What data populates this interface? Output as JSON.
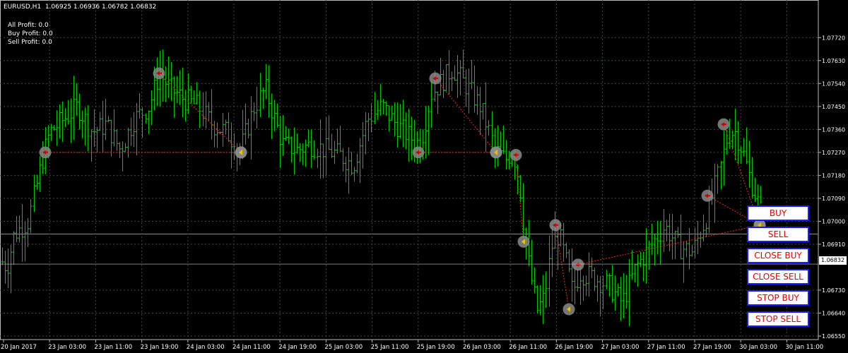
{
  "header": {
    "symbol_line": "EURUSD,H1  1.06925 1.06936 1.06782 1.06832",
    "all_profit": "All Profit: 0.0",
    "buy_profit": "Buy Profit: 0.0",
    "sell_profit": "Sell Profit: 0.0"
  },
  "buttons": {
    "buy": "BUY",
    "sell": "SELL",
    "close_buy": "CLOSE BUY",
    "close_sell": "CLOSE SELL",
    "stop_buy": "STOP BUY",
    "stop_sell": "STOP SELL"
  },
  "current_price": "1.06832",
  "colors": {
    "background": "#000000",
    "candles": "#00c800",
    "grid": "#3c4a4a",
    "trade_line": "#ff2222",
    "marker": "#8a8a8a",
    "button_border": "#1a1aff",
    "button_text": "#e00000"
  },
  "chart_data": {
    "type": "ohlc",
    "symbol": "EURUSD",
    "timeframe": "H1",
    "ylim": [
      1.0655,
      1.0775
    ],
    "y_ticks": [
      "1.07720",
      "1.07630",
      "1.07540",
      "1.07450",
      "1.07360",
      "1.07270",
      "1.07180",
      "1.07090",
      "1.07000",
      "1.06910",
      "1.06730",
      "1.06640",
      "1.06550"
    ],
    "x_ticks": [
      "20 Jan 2017",
      "23 Jan 03:00",
      "23 Jan 11:00",
      "23 Jan 19:00",
      "24 Jan 03:00",
      "24 Jan 11:00",
      "24 Jan 19:00",
      "25 Jan 03:00",
      "25 Jan 11:00",
      "25 Jan 19:00",
      "26 Jan 03:00",
      "26 Jan 11:00",
      "26 Jan 19:00",
      "27 Jan 03:00",
      "27 Jan 11:00",
      "27 Jan 19:00",
      "30 Jan 03:00",
      "30 Jan 11:00"
    ],
    "guide_price": 1.0695,
    "current_price": 1.06832,
    "price_path": [
      [
        0,
        1.0685
      ],
      [
        10,
        1.0682
      ],
      [
        20,
        1.0695
      ],
      [
        40,
        1.07
      ],
      [
        60,
        1.0725
      ],
      [
        70,
        1.0735
      ],
      [
        90,
        1.074
      ],
      [
        110,
        1.0745
      ],
      [
        130,
        1.0735
      ],
      [
        150,
        1.0738
      ],
      [
        170,
        1.0728
      ],
      [
        190,
        1.074
      ],
      [
        210,
        1.0745
      ],
      [
        225,
        1.0758
      ],
      [
        240,
        1.0752
      ],
      [
        260,
        1.0748
      ],
      [
        280,
        1.0745
      ],
      [
        300,
        1.0738
      ],
      [
        320,
        1.0735
      ],
      [
        340,
        1.0728
      ],
      [
        360,
        1.0745
      ],
      [
        375,
        1.0752
      ],
      [
        390,
        1.0738
      ],
      [
        400,
        1.073
      ],
      [
        420,
        1.0728
      ],
      [
        440,
        1.073
      ],
      [
        460,
        1.0728
      ],
      [
        480,
        1.0726
      ],
      [
        500,
        1.0722
      ],
      [
        520,
        1.074
      ],
      [
        540,
        1.0745
      ],
      [
        560,
        1.0738
      ],
      [
        580,
        1.0733
      ],
      [
        595,
        1.073
      ],
      [
        610,
        1.075
      ],
      [
        640,
        1.076
      ],
      [
        660,
        1.0753
      ],
      [
        680,
        1.0745
      ],
      [
        700,
        1.0728
      ],
      [
        715,
        1.0724
      ],
      [
        725,
        1.0728
      ],
      [
        735,
        1.0715
      ],
      [
        742,
        1.0695
      ],
      [
        750,
        1.068
      ],
      [
        760,
        1.0665
      ],
      [
        770,
        1.067
      ],
      [
        780,
        1.069
      ],
      [
        790,
        1.0695
      ],
      [
        800,
        1.0685
      ],
      [
        810,
        1.0672
      ],
      [
        820,
        1.068
      ],
      [
        840,
        1.0678
      ],
      [
        860,
        1.0675
      ],
      [
        880,
        1.0668
      ],
      [
        900,
        1.0682
      ],
      [
        920,
        1.069
      ],
      [
        940,
        1.0698
      ],
      [
        960,
        1.069
      ],
      [
        980,
        1.0688
      ],
      [
        1000,
        1.0702
      ],
      [
        1010,
        1.0712
      ],
      [
        1020,
        1.0722
      ],
      [
        1030,
        1.0735
      ],
      [
        1040,
        1.0735
      ],
      [
        1050,
        1.0728
      ],
      [
        1060,
        1.0718
      ],
      [
        1075,
        1.0705
      ],
      [
        1085,
        1.0698
      ]
    ],
    "trades": [
      {
        "open": [
          64,
          1.0727
        ],
        "close": [
          341,
          1.0727
        ]
      },
      {
        "open": [
          225,
          1.0758
        ],
        "close": [
          341,
          1.0727
        ]
      },
      {
        "open": [
          592,
          1.0727
        ],
        "close": [
          702,
          1.0727
        ]
      },
      {
        "open": [
          616,
          1.0756
        ],
        "close": [
          702,
          1.0727
        ]
      },
      {
        "open": [
          730,
          1.0726
        ],
        "close": [
          741,
          1.0692
        ]
      },
      {
        "open": [
          786,
          1.06985
        ],
        "close": [
          805,
          1.06655
        ]
      },
      {
        "open": [
          818,
          1.0683
        ],
        "close": [
          1075,
          1.06985
        ]
      },
      {
        "open": [
          1001,
          1.071
        ],
        "close": [
          1075,
          1.06985
        ]
      },
      {
        "open": [
          1024,
          1.0738
        ],
        "close": [
          1075,
          1.06985
        ]
      }
    ]
  }
}
